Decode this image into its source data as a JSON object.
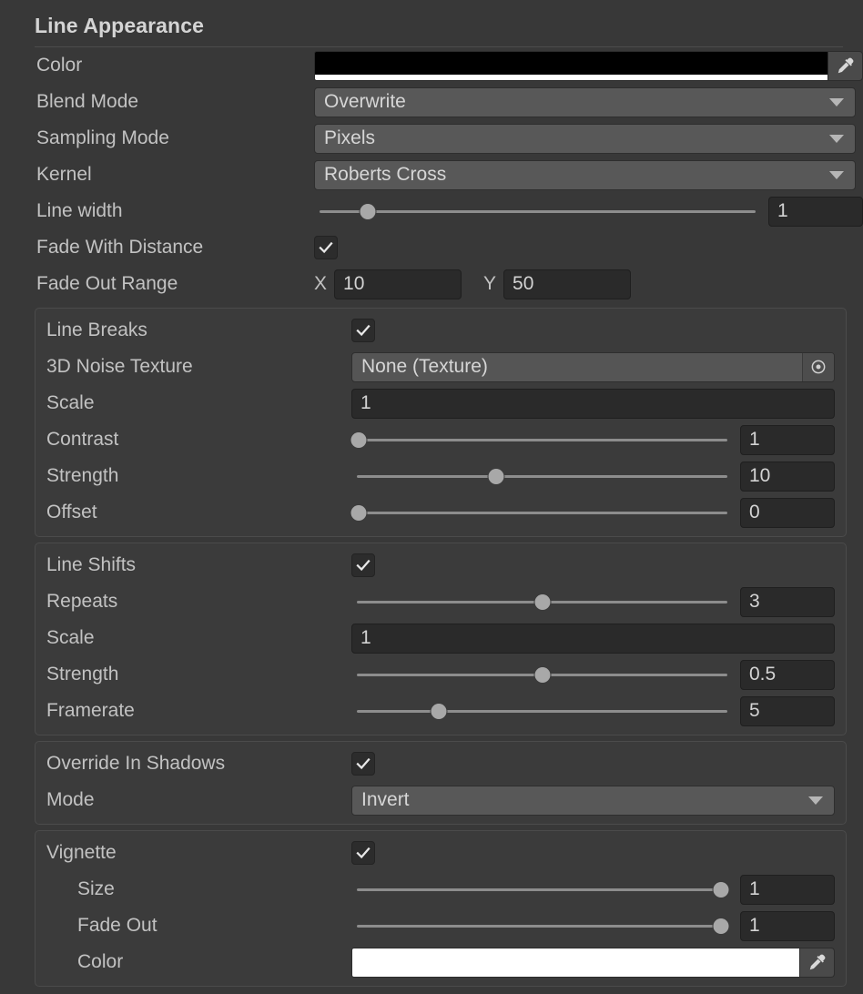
{
  "header": {
    "title": "Line Appearance"
  },
  "fields": {
    "color": {
      "label": "Color",
      "value": "#000000",
      "alpha_color": "#ffffff",
      "icon": "eyedropper-icon"
    },
    "blend_mode": {
      "label": "Blend Mode",
      "value": "Overwrite",
      "icon": "chevron-down-icon"
    },
    "sampling_mode": {
      "label": "Sampling Mode",
      "value": "Pixels",
      "icon": "chevron-down-icon"
    },
    "kernel": {
      "label": "Kernel",
      "value": "Roberts Cross",
      "icon": "chevron-down-icon"
    },
    "line_width": {
      "label": "Line width",
      "value": "1",
      "slider_percent": 12
    },
    "fade_with_distance": {
      "label": "Fade With Distance",
      "checked": true,
      "icon": "checkmark-icon"
    },
    "fade_out_range": {
      "label": "Fade Out Range",
      "x_axis": "X",
      "x_value": "10",
      "y_axis": "Y",
      "y_value": "50"
    }
  },
  "line_breaks": {
    "label": "Line Breaks",
    "checked": true,
    "noise_texture": {
      "label": "3D Noise Texture",
      "value": "None (Texture)",
      "icon": "object-picker-icon"
    },
    "scale": {
      "label": "Scale",
      "value": "1"
    },
    "contrast": {
      "label": "Contrast",
      "value": "1",
      "slider_percent": 2
    },
    "strength": {
      "label": "Strength",
      "value": "10",
      "slider_percent": 38
    },
    "offset": {
      "label": "Offset",
      "value": "0",
      "slider_percent": 2
    }
  },
  "line_shifts": {
    "label": "Line Shifts",
    "checked": true,
    "repeats": {
      "label": "Repeats",
      "value": "3",
      "slider_percent": 50
    },
    "scale": {
      "label": "Scale",
      "value": "1"
    },
    "strength": {
      "label": "Strength",
      "value": "0.5",
      "slider_percent": 50
    },
    "framerate": {
      "label": "Framerate",
      "value": "5",
      "slider_percent": 23
    }
  },
  "override_in_shadows": {
    "label": "Override In Shadows",
    "checked": true,
    "mode": {
      "label": "Mode",
      "value": "Invert",
      "icon": "chevron-down-icon"
    }
  },
  "vignette": {
    "label": "Vignette",
    "checked": true,
    "size": {
      "label": "Size",
      "value": "1",
      "slider_percent": 97
    },
    "fade_out": {
      "label": "Fade Out",
      "value": "1",
      "slider_percent": 97
    },
    "color": {
      "label": "Color",
      "value": "#ffffff",
      "icon": "eyedropper-icon"
    }
  }
}
